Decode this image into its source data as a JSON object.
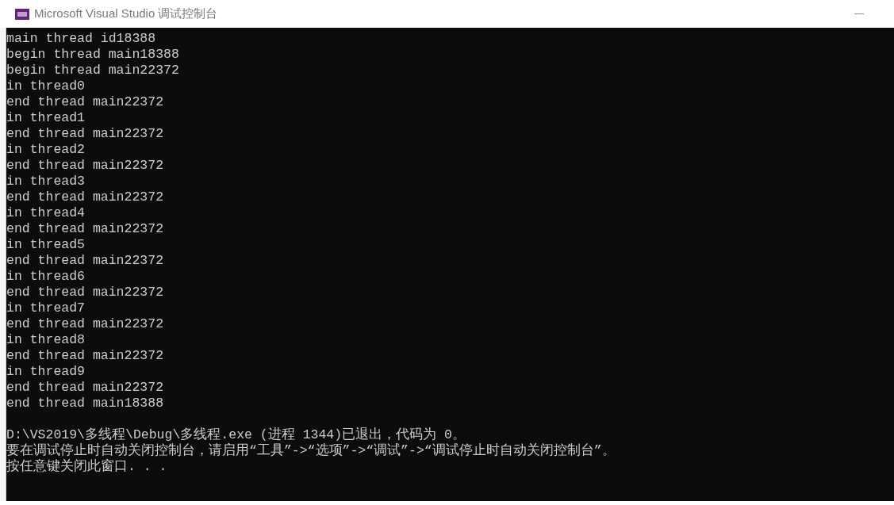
{
  "window": {
    "title": "Microsoft Visual Studio 调试控制台"
  },
  "console": {
    "output_lines": [
      "main thread id18388",
      "begin thread main18388",
      "begin thread main22372",
      "in thread0",
      "end thread main22372",
      "in thread1",
      "end thread main22372",
      "in thread2",
      "end thread main22372",
      "in thread3",
      "end thread main22372",
      "in thread4",
      "end thread main22372",
      "in thread5",
      "end thread main22372",
      "in thread6",
      "end thread main22372",
      "in thread7",
      "end thread main22372",
      "in thread8",
      "end thread main22372",
      "in thread9",
      "end thread main22372",
      "end thread main18388"
    ],
    "exit_lines": [
      "D:\\VS2019\\多线程\\Debug\\多线程.exe (进程 1344)已退出，代码为 0。",
      "要在调试停止时自动关闭控制台，请启用“工具”->“选项”->“调试”->“调试停止时自动关闭控制台”。",
      "按任意键关闭此窗口. . ."
    ]
  }
}
